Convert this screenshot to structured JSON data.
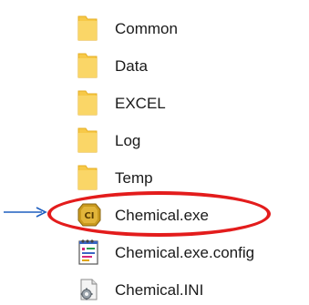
{
  "files": [
    {
      "name": "Common",
      "icon": "folder-icon"
    },
    {
      "name": "Data",
      "icon": "folder-icon"
    },
    {
      "name": "EXCEL",
      "icon": "folder-icon"
    },
    {
      "name": "Log",
      "icon": "folder-icon"
    },
    {
      "name": "Temp",
      "icon": "folder-icon"
    },
    {
      "name": "Chemical.exe",
      "icon": "exe-app-icon",
      "badge": "CI",
      "highlighted": true
    },
    {
      "name": "Chemical.exe.config",
      "icon": "config-file-icon"
    },
    {
      "name": "Chemical.INI",
      "icon": "ini-settings-icon"
    }
  ],
  "colors": {
    "folder": "#f7c948",
    "folder_dark": "#e6ae22",
    "highlight": "#e31c1c",
    "arrow": "#1f5fbf",
    "exe_gold": "#c99a1e"
  }
}
